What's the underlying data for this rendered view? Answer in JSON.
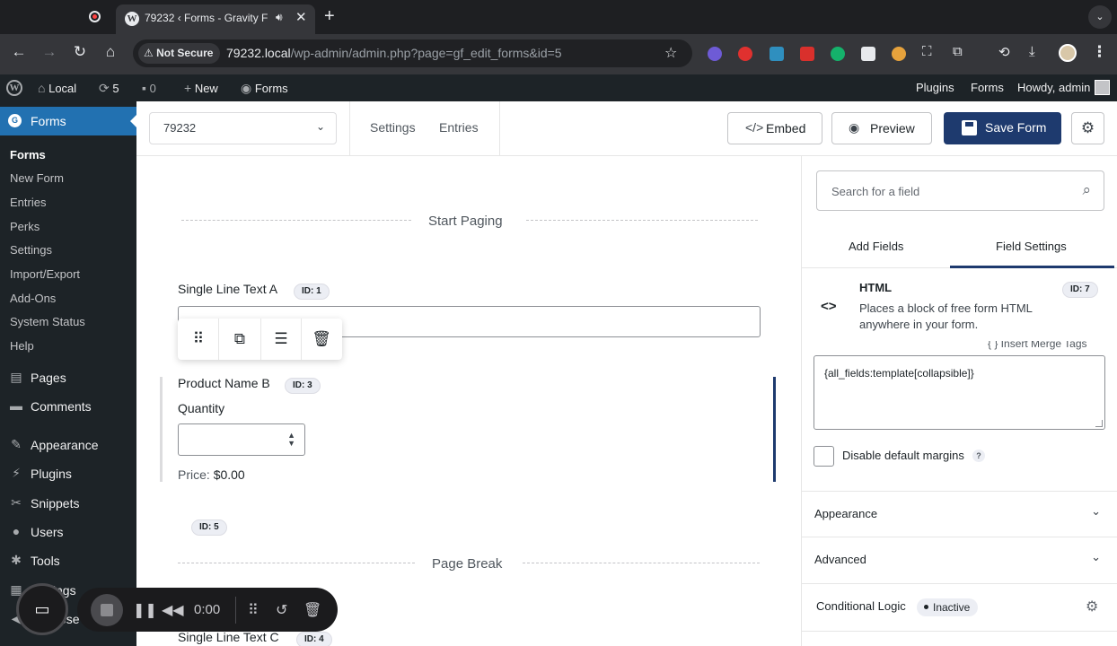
{
  "browser": {
    "tab_title": "79232 ‹ Forms - Gravity F",
    "security_label": "Not Secure",
    "url_host": "79232.local",
    "url_path": "/wp-admin/admin.php?page=gf_edit_forms&id=5"
  },
  "adminbar": {
    "site_name": "Local",
    "updates_count": "5",
    "comments_count": "0",
    "new_label": "New",
    "forms_label": "Forms",
    "right_plugins": "Plugins",
    "right_forms": "Forms",
    "howdy": "Howdy, admin"
  },
  "sidebar": {
    "forms_label": "Forms",
    "submenu": [
      "Forms",
      "New Form",
      "Entries",
      "Perks",
      "Settings",
      "Import/Export",
      "Add-Ons",
      "System Status",
      "Help"
    ],
    "menu": [
      {
        "label": "Pages",
        "icon": "pages-icon"
      },
      {
        "label": "Comments",
        "icon": "comments-icon"
      },
      {
        "label": "Appearance",
        "icon": "appearance-icon"
      },
      {
        "label": "Plugins",
        "icon": "plugins-icon"
      },
      {
        "label": "Snippets",
        "icon": "snippets-icon"
      },
      {
        "label": "Users",
        "icon": "users-icon"
      },
      {
        "label": "Tools",
        "icon": "tools-icon"
      },
      {
        "label": "Settings",
        "icon": "settings-icon"
      },
      {
        "label": "Collapse menu",
        "icon": "collapse-icon"
      }
    ]
  },
  "header": {
    "form_selector": "79232",
    "settings_link": "Settings",
    "entries_link": "Entries",
    "embed_label": "Embed",
    "preview_label": "Preview",
    "save_label": "Save Form"
  },
  "canvas": {
    "start_paging": "Start Paging",
    "field_a_label": "Single Line Text A",
    "field_a_id": "ID: 1",
    "field_b_label": "Product Name B",
    "field_b_id": "ID: 3",
    "quantity_label": "Quantity",
    "price_label": "Price:",
    "price_value": "$0.00",
    "html_field_id": "ID: 5",
    "page_break": "Page Break",
    "field_c_label": "Single Line Text C",
    "field_c_id": "ID: 4"
  },
  "recorder": {
    "time": "0:00"
  },
  "panel": {
    "search_placeholder": "Search for a field",
    "tab_add": "Add Fields",
    "tab_settings": "Field Settings",
    "field_title": "HTML",
    "field_id": "ID: 7",
    "field_desc": "Places a block of free form HTML anywhere in your form.",
    "merge_tags": "{ } Insert Merge Tags",
    "content_value": "{all_fields:template[collapsible]}",
    "disable_margins": "Disable default margins",
    "appearance": "Appearance",
    "advanced": "Advanced",
    "conditional_logic": "Conditional Logic",
    "conditional_status": "Inactive"
  }
}
